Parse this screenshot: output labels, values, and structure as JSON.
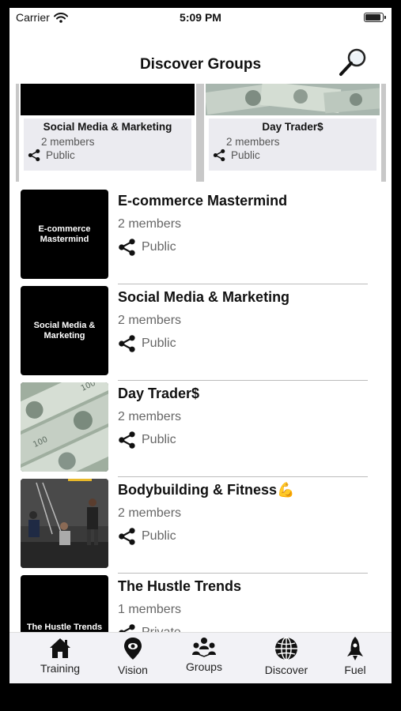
{
  "status_bar": {
    "carrier": "Carrier",
    "time": "5:09 PM"
  },
  "nav": {
    "title": "Discover Groups"
  },
  "featured": [
    {
      "name": "Social Media & Marketing",
      "members": "2 members",
      "privacy": "Public"
    },
    {
      "name": "Day Trader$",
      "members": "2 members",
      "privacy": "Public"
    }
  ],
  "groups": [
    {
      "title": "E-commerce Mastermind",
      "members": "2 members",
      "privacy": "Public",
      "thumb_text": "E-commerce Mastermind"
    },
    {
      "title": "Social Media & Marketing",
      "members": "2 members",
      "privacy": "Public",
      "thumb_text": "Social Media & Marketing"
    },
    {
      "title": "Day Trader$",
      "members": "2 members",
      "privacy": "Public",
      "thumb_text": ""
    },
    {
      "title": "Bodybuilding & Fitness💪",
      "members": "2 members",
      "privacy": "Public",
      "thumb_text": ""
    },
    {
      "title": "The Hustle Trends",
      "members": "1 members",
      "privacy": "Private",
      "thumb_text": "The Hustle Trends"
    }
  ],
  "tabs": [
    {
      "label": "Training",
      "icon": "house-icon"
    },
    {
      "label": "Vision",
      "icon": "map-pin-icon"
    },
    {
      "label": "Groups",
      "icon": "people-icon"
    },
    {
      "label": "Discover",
      "icon": "globe-icon"
    },
    {
      "label": "Fuel",
      "icon": "rocket-icon"
    }
  ]
}
